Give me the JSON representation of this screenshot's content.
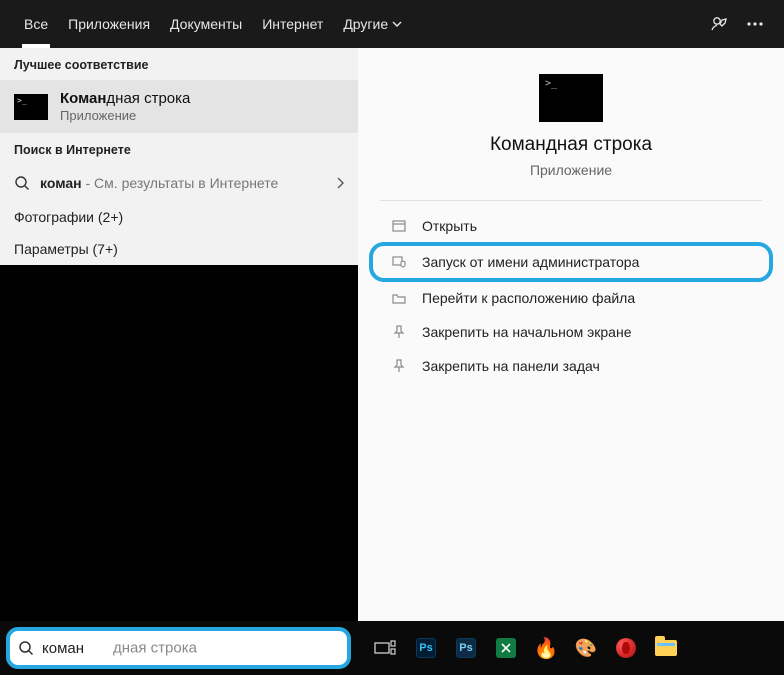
{
  "tabs": {
    "all": "Все",
    "apps": "Приложения",
    "docs": "Документы",
    "web": "Интернет",
    "more": "Другие"
  },
  "left": {
    "best_header": "Лучшее соответствие",
    "best_title_hi": "Коман",
    "best_title_rest": "дная строка",
    "best_sub": "Приложение",
    "web_header": "Поиск в Интернете",
    "web_query_b": "коман",
    "web_query_rest": " - См. результаты в Интернете",
    "photos": "Фотографии (2+)",
    "params": "Параметры (7+)"
  },
  "detail": {
    "title": "Командная строка",
    "sub": "Приложение",
    "open": "Открыть",
    "run_admin": "Запуск от имени администратора",
    "goto": "Перейти к расположению файла",
    "pin_start": "Закрепить на начальном экране",
    "pin_task": "Закрепить на панели задач"
  },
  "search": {
    "typed": "коман",
    "ghost": "дная строка"
  },
  "taskbar": {
    "ps": "Ps",
    "xl": "x"
  }
}
